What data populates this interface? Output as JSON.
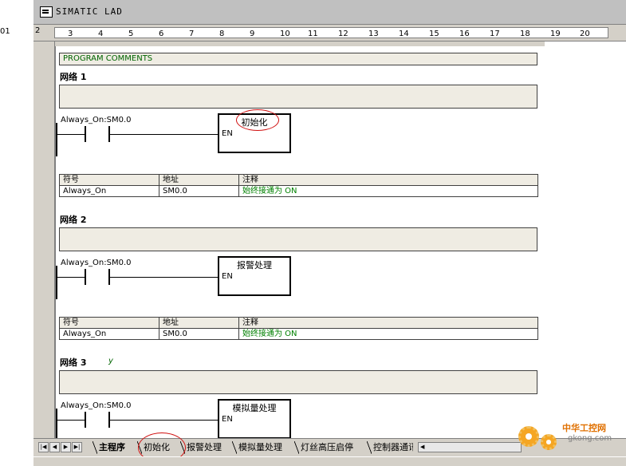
{
  "left_pane": {
    "fragment": "01"
  },
  "window": {
    "title": "SIMATIC LAD"
  },
  "ruler": {
    "ticks": [
      "2",
      "3",
      "4",
      "5",
      "6",
      "7",
      "8",
      "9",
      "10",
      "11",
      "12",
      "13",
      "14",
      "15",
      "16",
      "17",
      "18",
      "19",
      "20"
    ]
  },
  "program_comments": "PROGRAM COMMENTS",
  "table_headers": {
    "symbol": "符号",
    "address": "地址",
    "comment": "注释"
  },
  "networks": [
    {
      "title": "网络 1",
      "contact_label": "Always_On:SM0.0",
      "box_title": "初始化",
      "box_input": "EN",
      "symbol_row": {
        "symbol": "Always_On",
        "address": "SM0.0",
        "comment": "始终接通为 ON"
      }
    },
    {
      "title": "网络 2",
      "contact_label": "Always_On:SM0.0",
      "box_title": "报警处理",
      "box_input": "EN",
      "symbol_row": {
        "symbol": "Always_On",
        "address": "SM0.0",
        "comment": "始终接通为 ON"
      }
    },
    {
      "title": "网络 3",
      "annotation": "y",
      "contact_label": "Always_On:SM0.0",
      "box_title": "模拟量处理",
      "box_input": "EN"
    }
  ],
  "tabs": [
    {
      "label": "主程序",
      "active": true
    },
    {
      "label": "初始化",
      "active": false
    },
    {
      "label": "报警处理",
      "active": false
    },
    {
      "label": "模拟量处理",
      "active": false
    },
    {
      "label": "灯丝高压启停",
      "active": false
    },
    {
      "label": "控制器通讯",
      "active": false
    }
  ],
  "nav_buttons": [
    "first-icon",
    "prev-icon",
    "next-icon",
    "last-icon"
  ],
  "watermark": {
    "text": "中华工控网",
    "url": "gkong.com"
  },
  "colors": {
    "highlight_ellipse": "#d01010",
    "comment_text": "#008000",
    "comment_background": "#efece3"
  }
}
